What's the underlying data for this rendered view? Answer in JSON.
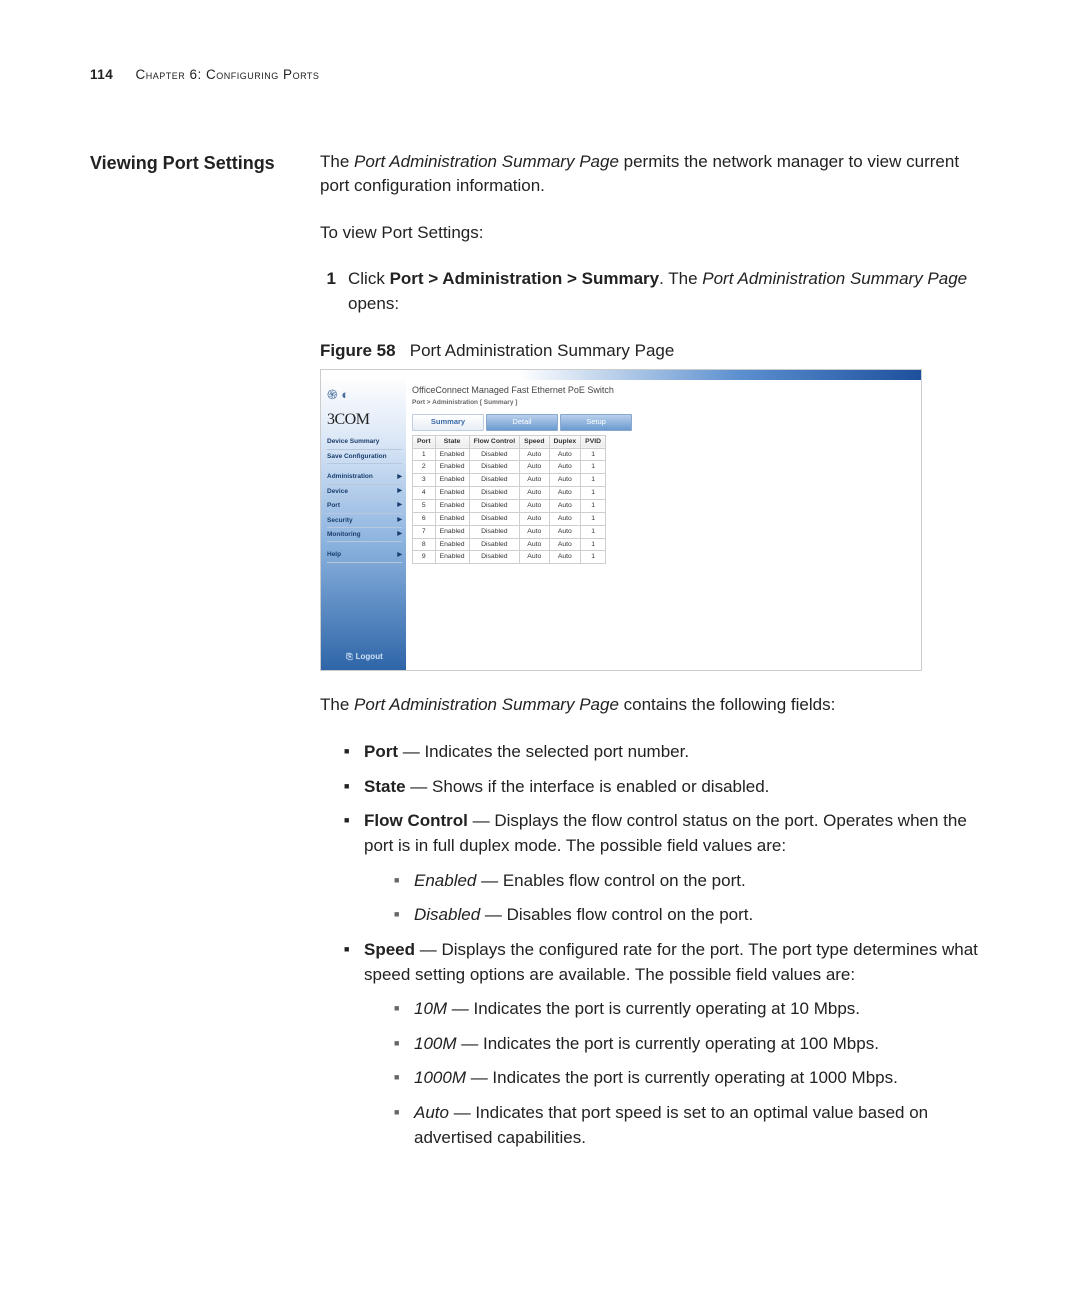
{
  "header": {
    "pageNumber": "114",
    "chapter": "Chapter 6: Configuring Ports"
  },
  "sectionTitle": "Viewing Port Settings",
  "intro": {
    "p1_pre": "The ",
    "p1_em": "Port Administration Summary Page",
    "p1_post": " permits the network manager to view current port configuration information.",
    "p2": "To view Port Settings:"
  },
  "step": {
    "num": "1",
    "pre": "Click ",
    "bold": "Port > Administration > Summary",
    "mid1": ". The ",
    "em": "Port Administration Summary Page",
    "post": " opens:"
  },
  "figure": {
    "labelBold": "Figure 58",
    "caption": "Port Administration Summary Page"
  },
  "screenshot": {
    "brand": "3COM",
    "title": "OfficeConnect Managed Fast Ethernet PoE Switch",
    "breadcrumb": "Port > Administration [ Summary ]",
    "tabs": {
      "summary": "Summary",
      "detail": "Detail",
      "setup": "Setup"
    },
    "sidebar": {
      "deviceSummary": "Device Summary",
      "saveConfig": "Save Configuration",
      "administration": "Administration",
      "device": "Device",
      "port": "Port",
      "security": "Security",
      "monitoring": "Monitoring",
      "help": "Help",
      "logout": "Logout"
    },
    "tableHeaders": {
      "port": "Port",
      "state": "State",
      "flow": "Flow Control",
      "speed": "Speed",
      "duplex": "Duplex",
      "pvid": "PVID"
    },
    "rows": [
      {
        "port": "1",
        "state": "Enabled",
        "flow": "Disabled",
        "speed": "Auto",
        "duplex": "Auto",
        "pvid": "1"
      },
      {
        "port": "2",
        "state": "Enabled",
        "flow": "Disabled",
        "speed": "Auto",
        "duplex": "Auto",
        "pvid": "1"
      },
      {
        "port": "3",
        "state": "Enabled",
        "flow": "Disabled",
        "speed": "Auto",
        "duplex": "Auto",
        "pvid": "1"
      },
      {
        "port": "4",
        "state": "Enabled",
        "flow": "Disabled",
        "speed": "Auto",
        "duplex": "Auto",
        "pvid": "1"
      },
      {
        "port": "5",
        "state": "Enabled",
        "flow": "Disabled",
        "speed": "Auto",
        "duplex": "Auto",
        "pvid": "1"
      },
      {
        "port": "6",
        "state": "Enabled",
        "flow": "Disabled",
        "speed": "Auto",
        "duplex": "Auto",
        "pvid": "1"
      },
      {
        "port": "7",
        "state": "Enabled",
        "flow": "Disabled",
        "speed": "Auto",
        "duplex": "Auto",
        "pvid": "1"
      },
      {
        "port": "8",
        "state": "Enabled",
        "flow": "Disabled",
        "speed": "Auto",
        "duplex": "Auto",
        "pvid": "1"
      },
      {
        "port": "9",
        "state": "Enabled",
        "flow": "Disabled",
        "speed": "Auto",
        "duplex": "Auto",
        "pvid": "1"
      }
    ]
  },
  "after": {
    "p3_pre": "The ",
    "p3_em": "Port Administration Summary Page",
    "p3_post": " contains the following fields:"
  },
  "fields": {
    "port": {
      "label": "Port",
      "desc": " — Indicates the selected port number."
    },
    "state": {
      "label": "State",
      "desc": " — Shows if the interface is enabled or disabled."
    },
    "flow": {
      "label": "Flow Control",
      "desc": " — Displays the flow control status on the port. Operates when the port is in full duplex mode. The possible field values are:",
      "vals": {
        "enabled": {
          "em": "Enabled",
          "rest": " — Enables flow control on the port."
        },
        "disabled": {
          "em": "Disabled",
          "rest": " — Disables flow control on the port."
        }
      }
    },
    "speed": {
      "label": "Speed",
      "desc": " — Displays the configured rate for the port. The port type determines what speed setting options are available. The possible field values are:",
      "vals": {
        "m10": {
          "em": "10M",
          "rest": " — Indicates the port is currently operating at 10 Mbps."
        },
        "m100": {
          "em": "100M",
          "rest": " — Indicates the port is currently operating at 100 Mbps."
        },
        "m1000": {
          "em": "1000M",
          "rest": " — Indicates the port is currently operating at 1000 Mbps."
        },
        "auto": {
          "em": "Auto",
          "rest": " — Indicates that port speed is set to an optimal value based on advertised capabilities."
        }
      }
    }
  }
}
